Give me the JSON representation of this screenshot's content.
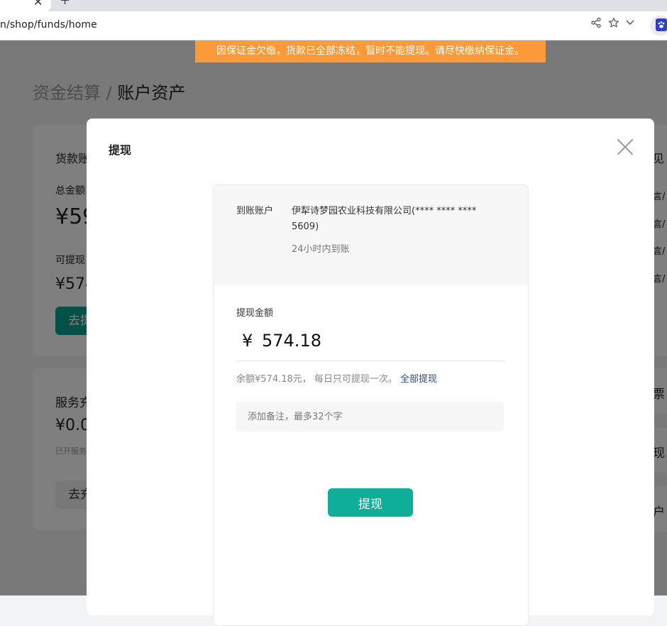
{
  "browser": {
    "tab_close": "✕",
    "new_tab": "+",
    "url": "n/shop/funds/home"
  },
  "notice": "因保证金欠缴，货款已全部冻结，暂时不能提现。请尽快缴纳保证金。",
  "breadcrumb": {
    "parent": "资金结算",
    "separator": "/",
    "current": "账户资产"
  },
  "background": {
    "goods_card": {
      "title": "货款账",
      "total_label": "总金额",
      "total_value": "¥59",
      "avail_label": "可提现",
      "avail_value": "¥574",
      "withdraw_btn": "去提"
    },
    "service_card": {
      "title": "服务充",
      "value": "¥0.0",
      "note": "已开服务",
      "recharge_btn": "去充"
    },
    "right_card": {
      "title": "见",
      "rows": [
        "言/",
        "言/",
        "言/",
        "言/"
      ]
    },
    "right_cards": [
      "票",
      "现",
      "户"
    ]
  },
  "modal": {
    "title": "提现",
    "account_label": "到账账户",
    "account_name": "伊犁诗梦园农业科技有限公司(**** **** **** 5609)",
    "arrival_time": "24小时内到账",
    "amount_label": "提现金额",
    "currency": "¥",
    "amount_value": "574.18",
    "balance_text": "余额¥574.18元， 每日只可提现一次。",
    "withdraw_all": "全部提现",
    "note_placeholder": "添加备注，最多32个字",
    "submit_label": "提现"
  },
  "colors": {
    "notice": "#fc9a3a",
    "primary": "#0fae98",
    "link": "#2f4a8a"
  }
}
